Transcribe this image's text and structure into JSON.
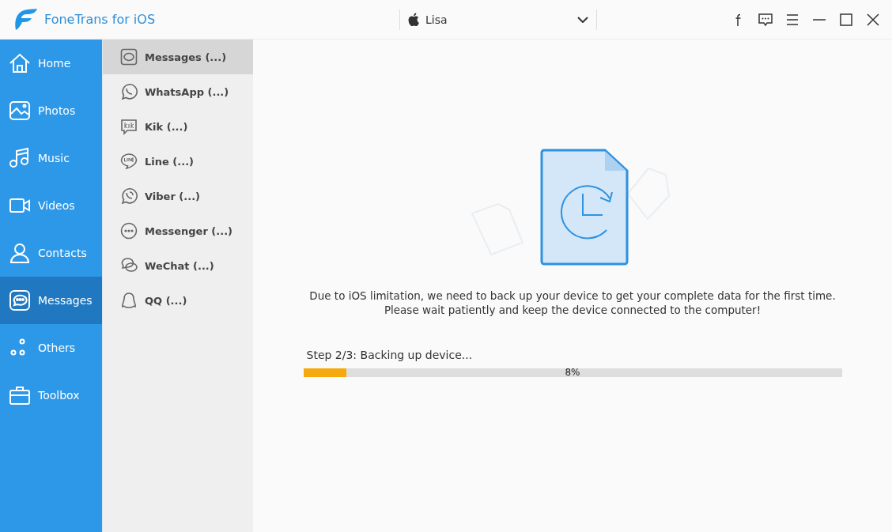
{
  "app": {
    "title": "FoneTrans for iOS"
  },
  "device": {
    "name": "Lisa"
  },
  "sidebar": {
    "items": [
      {
        "label": "Home",
        "selected": false
      },
      {
        "label": "Photos",
        "selected": false
      },
      {
        "label": "Music",
        "selected": false
      },
      {
        "label": "Videos",
        "selected": false
      },
      {
        "label": "Contacts",
        "selected": false
      },
      {
        "label": "Messages",
        "selected": true
      },
      {
        "label": "Others",
        "selected": false
      },
      {
        "label": "Toolbox",
        "selected": false
      }
    ]
  },
  "message_apps": [
    {
      "label": "Messages (...)",
      "selected": true
    },
    {
      "label": "WhatsApp (...)",
      "selected": false
    },
    {
      "label": "Kik (...)",
      "selected": false
    },
    {
      "label": "Line (...)",
      "selected": false
    },
    {
      "label": "Viber (...)",
      "selected": false
    },
    {
      "label": "Messenger (...)",
      "selected": false
    },
    {
      "label": "WeChat (...)",
      "selected": false
    },
    {
      "label": "QQ (...)",
      "selected": false
    }
  ],
  "notice": [
    "Due to iOS limitation, we need to back up your device to get your complete data for the first time.",
    "Please wait patiently and keep the device connected to the computer!"
  ],
  "progress": {
    "step": "Step 2/3: Backing up device...",
    "level": 0.08,
    "percent": "8%"
  }
}
